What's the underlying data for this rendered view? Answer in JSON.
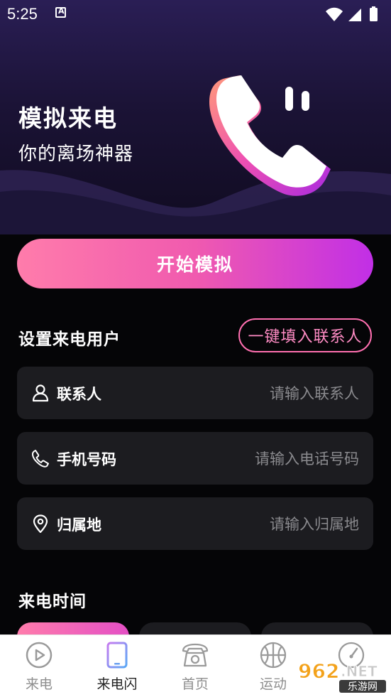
{
  "status_bar": {
    "time": "5:25",
    "notification_icon": "a-icon"
  },
  "hero": {
    "title": "模拟来电",
    "subtitle": "你的离场神器"
  },
  "start_button": {
    "label": "开始模拟"
  },
  "caller_section": {
    "title": "设置来电用户",
    "fill_contact_button": "一键填入联系人",
    "fields": [
      {
        "label": "联系人",
        "placeholder": "请输入联系人",
        "icon": "person-icon"
      },
      {
        "label": "手机号码",
        "placeholder": "请输入电话号码",
        "icon": "phone-icon"
      },
      {
        "label": "归属地",
        "placeholder": "请输入归属地",
        "icon": "location-pin-icon"
      }
    ]
  },
  "time_section": {
    "title": "来电时间"
  },
  "bottom_nav": {
    "items": [
      {
        "label": "来电",
        "icon": "play-circle-icon",
        "active": false
      },
      {
        "label": "来电闪",
        "icon": "phone-frame-icon",
        "active": true
      },
      {
        "label": "首页",
        "icon": "rotary-phone-icon",
        "active": false
      },
      {
        "label": "运动",
        "icon": "basketball-icon",
        "active": false
      },
      {
        "label": "",
        "icon": "speedometer-icon",
        "active": false
      }
    ]
  },
  "watermark": {
    "text": "962.NET",
    "sub": "乐游网"
  },
  "colors": {
    "accent_start": "#ff7cab",
    "accent_end": "#c12fe6",
    "field_bg": "#1c1c20"
  }
}
